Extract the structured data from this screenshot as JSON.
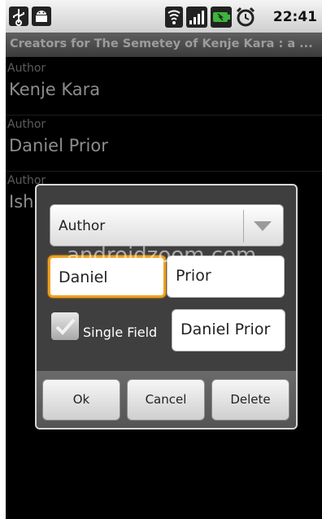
{
  "status_bar": {
    "time": "22:41",
    "icons": [
      "usb-icon",
      "android-icon",
      "wifi-icon",
      "signal-icon",
      "battery-icon",
      "alarm-icon"
    ]
  },
  "title": "Creators for The Semetey of Kenje Kara : a ...",
  "list": [
    {
      "label": "Author",
      "value": "Kenje Kara"
    },
    {
      "label": "Author",
      "value": "Daniel Prior"
    },
    {
      "label": "Author",
      "value": "Ish"
    }
  ],
  "dialog": {
    "role_select": "Author",
    "first_name": "Daniel",
    "last_name": "Prior",
    "single_field_label": "Single Field",
    "single_field_value": "Daniel Prior",
    "buttons": {
      "ok": "Ok",
      "cancel": "Cancel",
      "delete": "Delete"
    }
  },
  "watermark": "androidzoom.com",
  "colors": {
    "focus": "#f0a020",
    "background": "#000000"
  }
}
